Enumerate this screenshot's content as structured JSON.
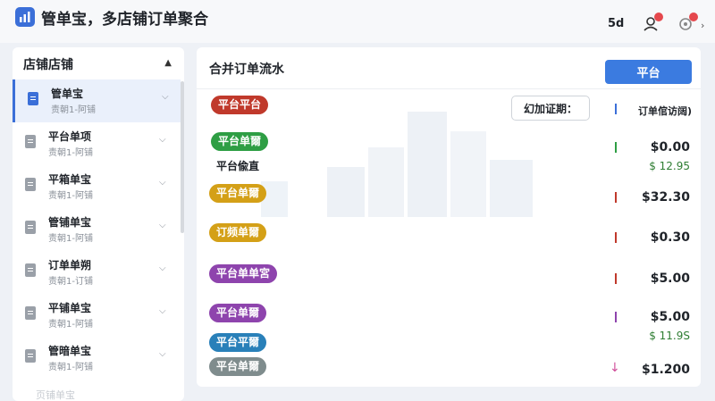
{
  "header": {
    "title": "管单宝，多店铺订单聚合",
    "count": "5d",
    "chevron": "›"
  },
  "sidebar": {
    "title": "店铺店铺",
    "items": [
      {
        "name": "管单宝",
        "sub": "责朝1-阿铺"
      },
      {
        "name": "平台单项",
        "sub": "责朝1-阿铺"
      },
      {
        "name": "平箱单宝",
        "sub": "责朝1-阿铺"
      },
      {
        "name": "管铺单宝",
        "sub": "责朝1-阿铺"
      },
      {
        "name": "订单单朔",
        "sub": "责朝1-订铺"
      },
      {
        "name": "平铺单宝",
        "sub": "责朝1-阿铺"
      },
      {
        "name": "管暗单宝",
        "sub": "责朝1-阿铺"
      }
    ],
    "faded_item": "页铺单宝"
  },
  "main": {
    "title": "合并订单流水",
    "platform_button": "平台",
    "filter_button": "幻加证期：",
    "column_header": "订单倌访阔)",
    "tags": [
      {
        "label": "平台平台",
        "color": "#c0392b"
      },
      {
        "label": "平台单爾",
        "color": "#2e9e44"
      },
      {
        "label": "平台单爾",
        "color": "#d4a017"
      },
      {
        "label": "订频单爾",
        "color": "#d4a017"
      },
      {
        "label": "平台单单宮",
        "color": "#8e44ad"
      },
      {
        "label": "平台单爾",
        "color": "#8e44ad"
      },
      {
        "label": "平台平爾",
        "color": "#2980b9"
      },
      {
        "label": "平台单爾",
        "color": "#7f8c8d"
      }
    ],
    "note": "平台偸直",
    "amounts": [
      {
        "value": "$0.00",
        "sub": "$ 12.95",
        "color": "#2e9e44"
      },
      {
        "value": "$32.30",
        "color": "#c0392b"
      },
      {
        "value": "$0.30",
        "color": "#c0392b"
      },
      {
        "value": "$5.00",
        "color": "#c0392b"
      },
      {
        "value": "$5.00",
        "sub": "$ 11.9S",
        "color": "#8e44ad"
      },
      {
        "value": "$1.200"
      }
    ],
    "arrow": "↓"
  }
}
